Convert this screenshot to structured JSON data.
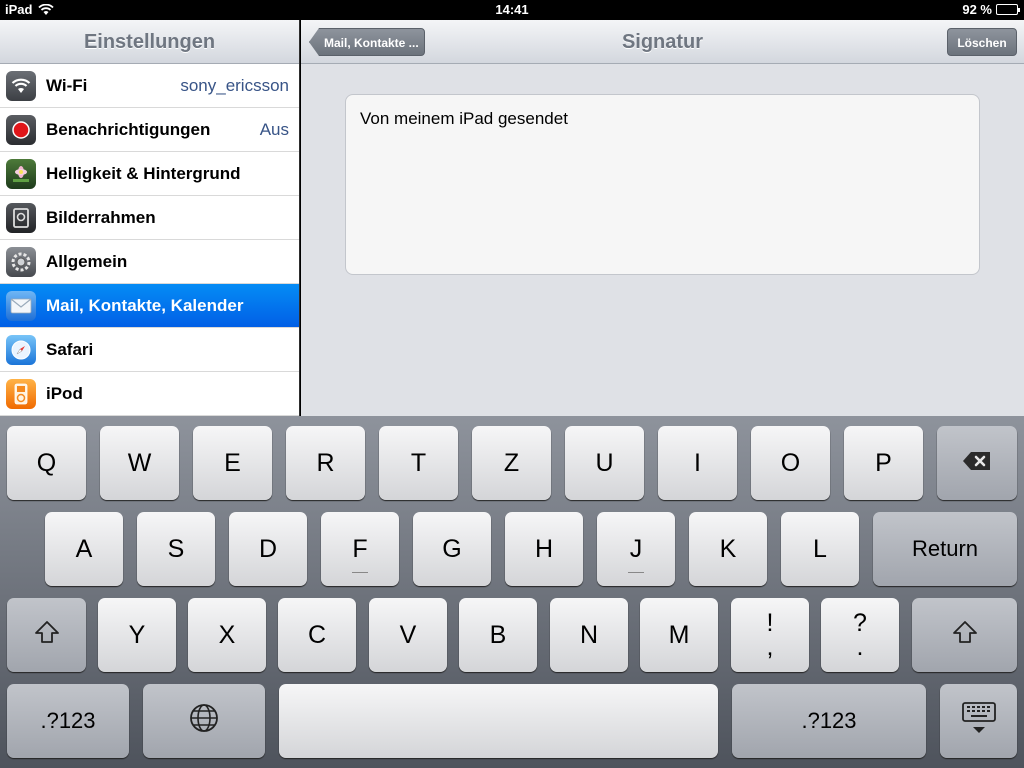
{
  "status_bar": {
    "device": "iPad",
    "time": "14:41",
    "battery": "92 %",
    "battery_level": 0.92
  },
  "master": {
    "title": "Einstellungen",
    "items": [
      {
        "label": "Wi-Fi",
        "value": "sony_ericsson",
        "icon": "wifi-icon"
      },
      {
        "label": "Benachrichtigungen",
        "value": "Aus",
        "icon": "notifications-icon"
      },
      {
        "label": "Helligkeit & Hintergrund",
        "value": "",
        "icon": "brightness-wallpaper-icon"
      },
      {
        "label": "Bilderrahmen",
        "value": "",
        "icon": "picture-frame-icon"
      },
      {
        "label": "Allgemein",
        "value": "",
        "icon": "gear-icon"
      },
      {
        "label": "Mail, Kontakte, Kalender",
        "value": "",
        "icon": "mail-icon",
        "selected": true
      },
      {
        "label": "Safari",
        "value": "",
        "icon": "safari-compass-icon"
      },
      {
        "label": "iPod",
        "value": "",
        "icon": "ipod-icon"
      }
    ]
  },
  "detail": {
    "title": "Signatur",
    "back_label": "Mail, Kontakte ...",
    "delete_label": "Löschen",
    "signature": "Von meinem iPad gesendet"
  },
  "keyboard": {
    "row1": [
      "Q",
      "W",
      "E",
      "R",
      "T",
      "Z",
      "U",
      "I",
      "O",
      "P"
    ],
    "row2": [
      "A",
      "S",
      "D",
      "F",
      "G",
      "H",
      "J",
      "K",
      "L"
    ],
    "return_label": "Return",
    "row3": [
      "Y",
      "X",
      "C",
      "V",
      "B",
      "N",
      "M"
    ],
    "punct1": [
      "!",
      ","
    ],
    "punct2": [
      "?",
      "."
    ],
    "numbers_label": ".?123"
  }
}
